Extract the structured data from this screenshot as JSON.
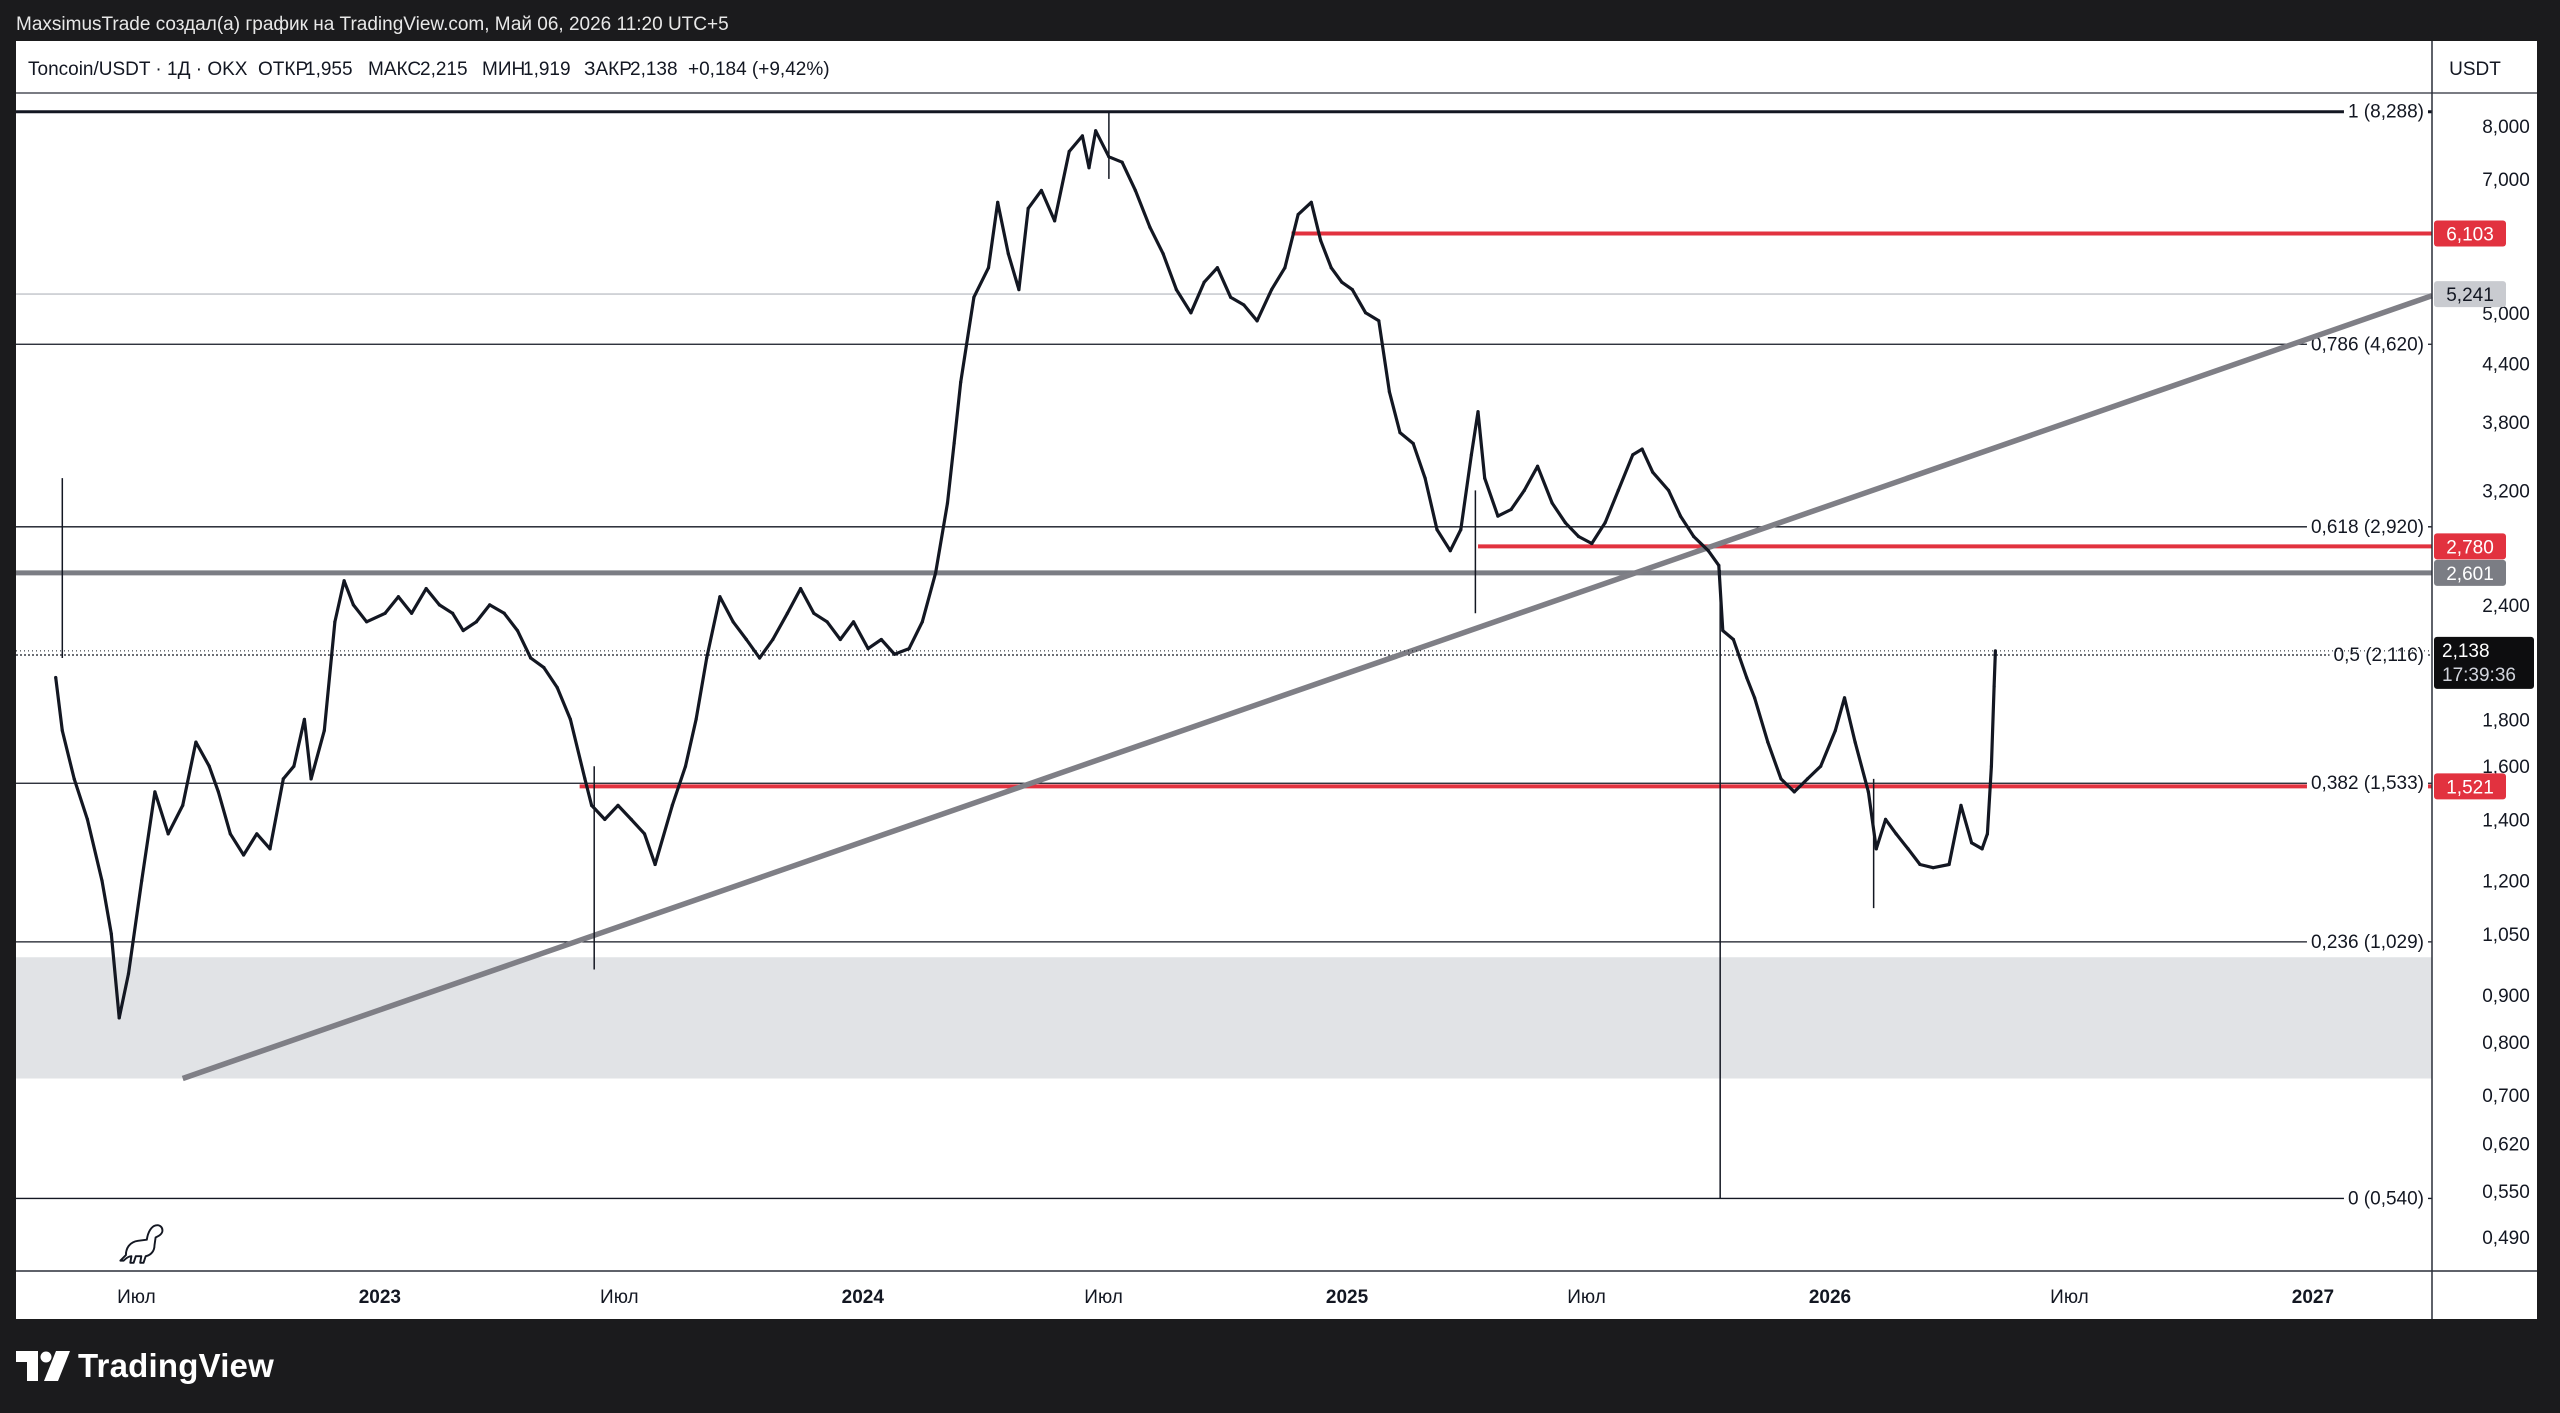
{
  "caption": "MaxsimusTrade создал(а) график на TradingView.com, Май 06, 2026 11:20 UTC+5",
  "header": {
    "symbol": "Toncoin/USDT · 1Д · OKX",
    "open_label": "ОТКР",
    "open": "1,955",
    "high_label": "МАКС",
    "high": "2,215",
    "low_label": "МИН",
    "low": "1,919",
    "close_label": "ЗАКР",
    "close": "2,138",
    "change": "+0,184 (+9,42%)"
  },
  "currency": "USDT",
  "footer_brand": "TradingView",
  "chart_data": {
    "type": "line",
    "price_scale": "log",
    "ylim": [
      0.45,
      8.6
    ],
    "xlim": [
      "2022-04-01",
      "2027-04-01"
    ],
    "x_ticks": [
      {
        "date": "2022-07-01",
        "label": "Июл",
        "bold": false
      },
      {
        "date": "2023-01-01",
        "label": "2023",
        "bold": true
      },
      {
        "date": "2023-07-01",
        "label": "Июл",
        "bold": false
      },
      {
        "date": "2024-01-01",
        "label": "2024",
        "bold": true
      },
      {
        "date": "2024-07-01",
        "label": "Июл",
        "bold": false
      },
      {
        "date": "2025-01-01",
        "label": "2025",
        "bold": true
      },
      {
        "date": "2025-07-01",
        "label": "Июл",
        "bold": false
      },
      {
        "date": "2026-01-01",
        "label": "2026",
        "bold": true
      },
      {
        "date": "2026-07-01",
        "label": "Июл",
        "bold": false
      },
      {
        "date": "2027-01-01",
        "label": "2027",
        "bold": true
      }
    ],
    "y_ticks": [
      {
        "value": 8.0,
        "label": "8,000"
      },
      {
        "value": 7.0,
        "label": "7,000"
      },
      {
        "value": 5.0,
        "label": "5,000"
      },
      {
        "value": 4.4,
        "label": "4,400"
      },
      {
        "value": 3.8,
        "label": "3,800"
      },
      {
        "value": 3.2,
        "label": "3,200"
      },
      {
        "value": 2.4,
        "label": "2,400"
      },
      {
        "value": 1.8,
        "label": "1,800"
      },
      {
        "value": 1.6,
        "label": "1,600"
      },
      {
        "value": 1.4,
        "label": "1,400"
      },
      {
        "value": 1.2,
        "label": "1,200"
      },
      {
        "value": 1.05,
        "label": "1,050"
      },
      {
        "value": 0.9,
        "label": "0,900"
      },
      {
        "value": 0.8,
        "label": "0,800"
      },
      {
        "value": 0.7,
        "label": "0,700"
      },
      {
        "value": 0.62,
        "label": "0,620"
      },
      {
        "value": 0.55,
        "label": "0,550"
      },
      {
        "value": 0.49,
        "label": "0,490"
      }
    ],
    "fib_levels": [
      {
        "ratio": "1",
        "value": 8.288,
        "label": "1 (8,288)"
      },
      {
        "ratio": "0.786",
        "value": 4.62,
        "label": "0,786 (4,620)"
      },
      {
        "ratio": "0.618",
        "value": 2.92,
        "label": "0,618 (2,920)"
      },
      {
        "ratio": "0.5",
        "value": 2.116,
        "label": "0,5 (2,116)"
      },
      {
        "ratio": "0.382",
        "value": 1.533,
        "label": "0,382 (1,533)"
      },
      {
        "ratio": "0.236",
        "value": 1.029,
        "label": "0,236 (1,029)"
      },
      {
        "ratio": "0",
        "value": 0.54,
        "label": "0 (0,540)"
      }
    ],
    "horizontal_levels": [
      {
        "value": 6.103,
        "label": "6,103",
        "color": "#e2323f",
        "from_date": "2024-11-20"
      },
      {
        "value": 5.241,
        "label": "5,241",
        "color": "#c9cbd0",
        "from_date": "2022-04-01"
      },
      {
        "value": 2.78,
        "label": "2,780",
        "color": "#e2323f",
        "from_date": "2025-04-10"
      },
      {
        "value": 2.601,
        "label": "2,601",
        "color": "#7b7d84",
        "from_date": "2022-04-01"
      },
      {
        "value": 1.521,
        "label": "1,521",
        "color": "#e2323f",
        "from_date": "2023-06-01"
      }
    ],
    "demand_zone": {
      "from": 0.73,
      "to": 0.99,
      "color": "#e1e3e6"
    },
    "trendline": {
      "from": {
        "date": "2022-08-05",
        "price": 0.73
      },
      "to": {
        "date": "2027-04-01",
        "price": 5.22
      },
      "color": "#7f7f86"
    },
    "wick_spike": {
      "date": "2025-10-10",
      "low": 0.54,
      "high": 2.62
    },
    "last_price": {
      "value": 2.138,
      "label": "2,138",
      "countdown": "17:39:36"
    },
    "series": [
      {
        "points": [
          [
            "2022-05-01",
            2.0
          ],
          [
            "2022-05-06",
            1.75
          ],
          [
            "2022-05-15",
            1.55
          ],
          [
            "2022-05-25",
            1.4
          ],
          [
            "2022-06-05",
            1.2
          ],
          [
            "2022-06-12",
            1.05
          ],
          [
            "2022-06-18",
            0.85
          ],
          [
            "2022-06-25",
            0.95
          ],
          [
            "2022-07-05",
            1.2
          ],
          [
            "2022-07-15",
            1.5
          ],
          [
            "2022-07-25",
            1.35
          ],
          [
            "2022-08-05",
            1.45
          ],
          [
            "2022-08-15",
            1.7
          ],
          [
            "2022-08-25",
            1.6
          ],
          [
            "2022-09-01",
            1.5
          ],
          [
            "2022-09-10",
            1.35
          ],
          [
            "2022-09-20",
            1.28
          ],
          [
            "2022-09-30",
            1.35
          ],
          [
            "2022-10-10",
            1.3
          ],
          [
            "2022-10-20",
            1.55
          ],
          [
            "2022-10-28",
            1.6
          ],
          [
            "2022-11-05",
            1.8
          ],
          [
            "2022-11-10",
            1.55
          ],
          [
            "2022-11-20",
            1.75
          ],
          [
            "2022-11-28",
            2.3
          ],
          [
            "2022-12-05",
            2.55
          ],
          [
            "2022-12-12",
            2.4
          ],
          [
            "2022-12-22",
            2.3
          ],
          [
            "2023-01-05",
            2.35
          ],
          [
            "2023-01-15",
            2.45
          ],
          [
            "2023-01-25",
            2.35
          ],
          [
            "2023-02-05",
            2.5
          ],
          [
            "2023-02-15",
            2.4
          ],
          [
            "2023-02-25",
            2.35
          ],
          [
            "2023-03-05",
            2.25
          ],
          [
            "2023-03-15",
            2.3
          ],
          [
            "2023-03-25",
            2.4
          ],
          [
            "2023-04-05",
            2.35
          ],
          [
            "2023-04-15",
            2.25
          ],
          [
            "2023-04-25",
            2.1
          ],
          [
            "2023-05-05",
            2.05
          ],
          [
            "2023-05-15",
            1.95
          ],
          [
            "2023-05-25",
            1.8
          ],
          [
            "2023-06-05",
            1.55
          ],
          [
            "2023-06-10",
            1.45
          ],
          [
            "2023-06-20",
            1.4
          ],
          [
            "2023-06-30",
            1.45
          ],
          [
            "2023-07-10",
            1.4
          ],
          [
            "2023-07-20",
            1.35
          ],
          [
            "2023-07-28",
            1.25
          ],
          [
            "2023-08-10",
            1.45
          ],
          [
            "2023-08-20",
            1.6
          ],
          [
            "2023-08-28",
            1.8
          ],
          [
            "2023-09-05",
            2.1
          ],
          [
            "2023-09-15",
            2.45
          ],
          [
            "2023-09-25",
            2.3
          ],
          [
            "2023-10-05",
            2.2
          ],
          [
            "2023-10-15",
            2.1
          ],
          [
            "2023-10-25",
            2.2
          ],
          [
            "2023-11-05",
            2.35
          ],
          [
            "2023-11-15",
            2.5
          ],
          [
            "2023-11-25",
            2.35
          ],
          [
            "2023-12-05",
            2.3
          ],
          [
            "2023-12-15",
            2.2
          ],
          [
            "2023-12-25",
            2.3
          ],
          [
            "2024-01-05",
            2.15
          ],
          [
            "2024-01-15",
            2.2
          ],
          [
            "2024-01-25",
            2.12
          ],
          [
            "2024-02-05",
            2.15
          ],
          [
            "2024-02-15",
            2.3
          ],
          [
            "2024-02-25",
            2.6
          ],
          [
            "2024-03-05",
            3.1
          ],
          [
            "2024-03-10",
            3.6
          ],
          [
            "2024-03-15",
            4.2
          ],
          [
            "2024-03-25",
            5.2
          ],
          [
            "2024-04-05",
            5.6
          ],
          [
            "2024-04-12",
            6.6
          ],
          [
            "2024-04-20",
            5.8
          ],
          [
            "2024-04-28",
            5.3
          ],
          [
            "2024-05-05",
            6.5
          ],
          [
            "2024-05-15",
            6.8
          ],
          [
            "2024-05-25",
            6.3
          ],
          [
            "2024-06-05",
            7.5
          ],
          [
            "2024-06-15",
            7.8
          ],
          [
            "2024-06-20",
            7.2
          ],
          [
            "2024-06-25",
            7.9
          ],
          [
            "2024-07-05",
            7.4
          ],
          [
            "2024-07-15",
            7.3
          ],
          [
            "2024-07-25",
            6.8
          ],
          [
            "2024-08-05",
            6.2
          ],
          [
            "2024-08-15",
            5.8
          ],
          [
            "2024-08-25",
            5.3
          ],
          [
            "2024-09-05",
            5.0
          ],
          [
            "2024-09-15",
            5.4
          ],
          [
            "2024-09-25",
            5.6
          ],
          [
            "2024-10-05",
            5.2
          ],
          [
            "2024-10-15",
            5.1
          ],
          [
            "2024-10-25",
            4.9
          ],
          [
            "2024-11-05",
            5.3
          ],
          [
            "2024-11-15",
            5.6
          ],
          [
            "2024-11-25",
            6.4
          ],
          [
            "2024-12-05",
            6.6
          ],
          [
            "2024-12-12",
            6.0
          ],
          [
            "2024-12-20",
            5.6
          ],
          [
            "2024-12-28",
            5.4
          ],
          [
            "2025-01-05",
            5.3
          ],
          [
            "2025-01-15",
            5.0
          ],
          [
            "2025-01-25",
            4.9
          ],
          [
            "2025-02-02",
            4.1
          ],
          [
            "2025-02-10",
            3.7
          ],
          [
            "2025-02-20",
            3.6
          ],
          [
            "2025-03-01",
            3.3
          ],
          [
            "2025-03-10",
            2.9
          ],
          [
            "2025-03-20",
            2.75
          ],
          [
            "2025-03-28",
            2.9
          ],
          [
            "2025-04-05",
            3.5
          ],
          [
            "2025-04-10",
            3.9
          ],
          [
            "2025-04-15",
            3.3
          ],
          [
            "2025-04-25",
            3.0
          ],
          [
            "2025-05-05",
            3.05
          ],
          [
            "2025-05-15",
            3.2
          ],
          [
            "2025-05-25",
            3.4
          ],
          [
            "2025-06-05",
            3.1
          ],
          [
            "2025-06-15",
            2.95
          ],
          [
            "2025-06-25",
            2.85
          ],
          [
            "2025-07-05",
            2.8
          ],
          [
            "2025-07-15",
            2.95
          ],
          [
            "2025-07-25",
            3.2
          ],
          [
            "2025-08-05",
            3.5
          ],
          [
            "2025-08-12",
            3.55
          ],
          [
            "2025-08-20",
            3.35
          ],
          [
            "2025-09-01",
            3.2
          ],
          [
            "2025-09-10",
            3.0
          ],
          [
            "2025-09-20",
            2.85
          ],
          [
            "2025-10-01",
            2.75
          ],
          [
            "2025-10-09",
            2.65
          ],
          [
            "2025-10-12",
            2.25
          ],
          [
            "2025-10-20",
            2.2
          ],
          [
            "2025-10-30",
            2.0
          ],
          [
            "2025-11-05",
            1.9
          ],
          [
            "2025-11-15",
            1.7
          ],
          [
            "2025-11-25",
            1.55
          ],
          [
            "2025-12-05",
            1.5
          ],
          [
            "2025-12-15",
            1.55
          ],
          [
            "2025-12-25",
            1.6
          ],
          [
            "2026-01-05",
            1.75
          ],
          [
            "2026-01-12",
            1.9
          ],
          [
            "2026-01-20",
            1.7
          ],
          [
            "2026-01-30",
            1.5
          ],
          [
            "2026-02-05",
            1.3
          ],
          [
            "2026-02-12",
            1.4
          ],
          [
            "2026-02-20",
            1.35
          ],
          [
            "2026-03-01",
            1.3
          ],
          [
            "2026-03-10",
            1.25
          ],
          [
            "2026-03-20",
            1.24
          ],
          [
            "2026-04-01",
            1.25
          ],
          [
            "2026-04-10",
            1.45
          ],
          [
            "2026-04-18",
            1.32
          ],
          [
            "2026-04-26",
            1.3
          ],
          [
            "2026-04-30",
            1.35
          ],
          [
            "2026-05-03",
            1.6
          ],
          [
            "2026-05-05",
            1.955
          ],
          [
            "2026-05-06",
            2.138
          ]
        ]
      }
    ],
    "wick_markers": [
      {
        "date": "2022-05-06",
        "high": 3.3,
        "low": 2.1
      },
      {
        "date": "2023-06-12",
        "high": 1.6,
        "low": 0.96
      },
      {
        "date": "2024-07-05",
        "high": 8.288,
        "low": 7.0
      },
      {
        "date": "2025-04-08",
        "high": 3.2,
        "low": 2.35
      },
      {
        "date": "2026-02-03",
        "high": 1.55,
        "low": 1.12
      }
    ]
  }
}
